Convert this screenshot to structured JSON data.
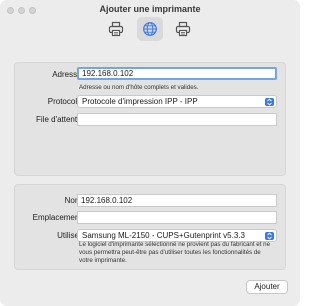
{
  "window": {
    "title": "Ajouter une imprimante"
  },
  "toolbar": {
    "tabs": [
      {
        "icon": "printer-icon",
        "active": false
      },
      {
        "icon": "globe-icon",
        "active": true
      },
      {
        "icon": "printer-icon",
        "active": false
      }
    ]
  },
  "ip_panel": {
    "address_label": "Adresse :",
    "address_value": "192.168.0.102",
    "address_help": "Adresse ou nom d'hôte complets et valides.",
    "protocol_label": "Protocole :",
    "protocol_value": "Protocole d'impression IPP - IPP",
    "queue_label": "File d'attente :",
    "queue_value": ""
  },
  "details_panel": {
    "name_label": "Nom :",
    "name_value": "192.168.0.102",
    "location_label": "Emplacement :",
    "location_value": "",
    "use_label": "Utiliser :",
    "use_value": "Samsung ML-2150 - CUPS+Gutenprint v5.3.3",
    "driver_note": "Le logiciel d'imprimante sélectionné ne provient pas du fabricant et ne vous permettra peut-être pas d'utiliser toutes les fonctionnalités de votre imprimante."
  },
  "footer": {
    "add_label": "Ajouter"
  },
  "colors": {
    "accent": "#3478f6",
    "focus_ring": "#74a4e6"
  }
}
